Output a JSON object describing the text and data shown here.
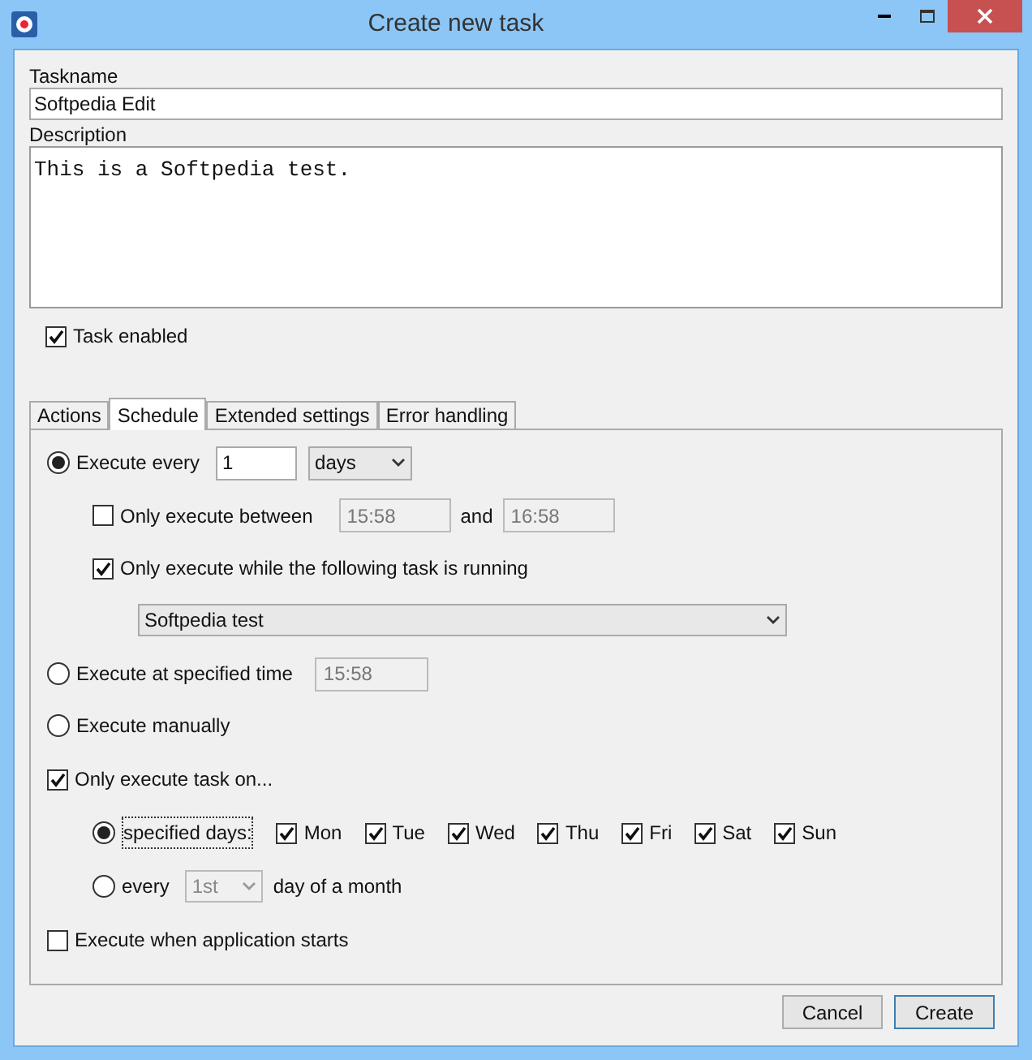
{
  "window": {
    "title": "Create new task"
  },
  "taskname": {
    "label": "Taskname",
    "value": "Softpedia Edit"
  },
  "description": {
    "label": "Description",
    "value": "This is a Softpedia test."
  },
  "task_enabled": {
    "label": "Task enabled",
    "checked": true
  },
  "tabs": [
    {
      "label": "Actions",
      "selected": false
    },
    {
      "label": "Schedule",
      "selected": true
    },
    {
      "label": "Extended settings",
      "selected": false
    },
    {
      "label": "Error handling",
      "selected": false
    }
  ],
  "schedule": {
    "execute_every": {
      "label": "Execute every",
      "selected": true,
      "value": "1",
      "unit": "days"
    },
    "only_between": {
      "label": "Only execute between",
      "checked": false,
      "from": "15:58",
      "and_label": "and",
      "to": "16:58"
    },
    "only_while_running": {
      "label": "Only execute while the following task is running",
      "checked": true,
      "task": "Softpedia test"
    },
    "specified_time": {
      "label": "Execute at specified time",
      "selected": false,
      "value": "15:58"
    },
    "manually": {
      "label": "Execute manually",
      "selected": false
    },
    "only_on": {
      "label": "Only execute task on...",
      "checked": true
    },
    "specified_days": {
      "label": "specified days:",
      "selected": true,
      "days": [
        {
          "label": "Mon",
          "checked": true
        },
        {
          "label": "Tue",
          "checked": true
        },
        {
          "label": "Wed",
          "checked": true
        },
        {
          "label": "Thu",
          "checked": true
        },
        {
          "label": "Fri",
          "checked": true
        },
        {
          "label": "Sat",
          "checked": true
        },
        {
          "label": "Sun",
          "checked": true
        }
      ]
    },
    "every_month": {
      "label": "every",
      "selected": false,
      "value": "1st",
      "suffix": "day of a month"
    },
    "app_starts": {
      "label": "Execute when application starts",
      "checked": false
    }
  },
  "buttons": [
    {
      "label": "Cancel",
      "default": false
    },
    {
      "label": "Create",
      "default": true
    }
  ]
}
